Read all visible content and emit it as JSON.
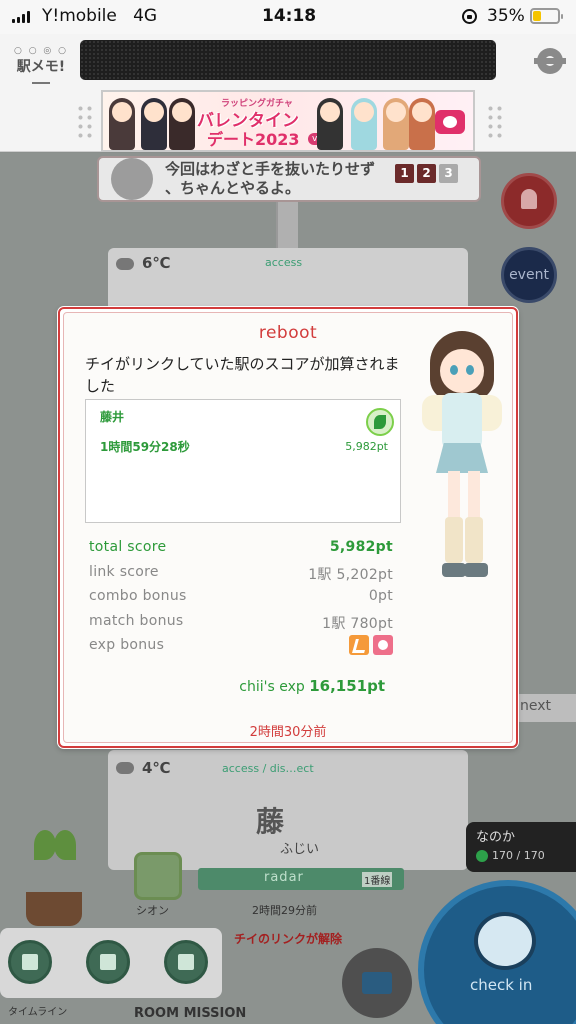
{
  "status_bar": {
    "carrier": "Y!mobile",
    "network": "4G",
    "time": "14:18",
    "battery_percent": "35%",
    "battery_level": 0.35
  },
  "header": {
    "logo_text": "駅メモ!",
    "banner": {
      "small_text": "ラッピングガチャ",
      "title": "バレンタイン",
      "title_line2": "デート2023",
      "vol": "vol.3"
    }
  },
  "background": {
    "bubble_text_1": "今回はわざと手を抜いたりせず",
    "bubble_text_2": "、ちゃんとやるよ。",
    "bubble_pages": [
      "1",
      "2",
      "3"
    ],
    "card1_weather": "6℃",
    "card1_access": "access",
    "card2_weather": "4℃",
    "card2_access": "access / dis…ect",
    "station_partial": "藤",
    "station_reading": "ふじい",
    "shion_name": "シオン",
    "radar_label": "radar",
    "radar_line": "1番線",
    "elapsed_text": "2時間29分前",
    "chii_link_text": "チイのリンクが解除",
    "next_label": "next",
    "nanoka_name": "なのか",
    "nanoka_exp": "170 / 170",
    "event_label": "event",
    "checkin_label": "check in",
    "timeline_label": "タイムライン",
    "mission_label": "ROOM MISSION"
  },
  "modal": {
    "title": "reboot",
    "message": "チイがリンクしていた駅のスコアが加算されました",
    "detail": {
      "station": "藤井",
      "duration": "1時間59分28秒",
      "points": "5,982pt"
    },
    "scores": [
      {
        "label": "total score",
        "value": "5,982pt"
      },
      {
        "label": "link score",
        "value": "1駅 5,202pt"
      },
      {
        "label": "combo bonus",
        "value": "0pt"
      },
      {
        "label": "match bonus",
        "value": "1駅 780pt"
      },
      {
        "label": "exp bonus",
        "value": ""
      }
    ],
    "chii_exp_label": "chii's exp",
    "chii_exp_value": "16,151pt",
    "elapsed": "2時間30分前"
  },
  "colors": {
    "accent_red": "#d23c3c",
    "score_green": "#2d9a3a",
    "battery_yellow": "#f5c400"
  }
}
